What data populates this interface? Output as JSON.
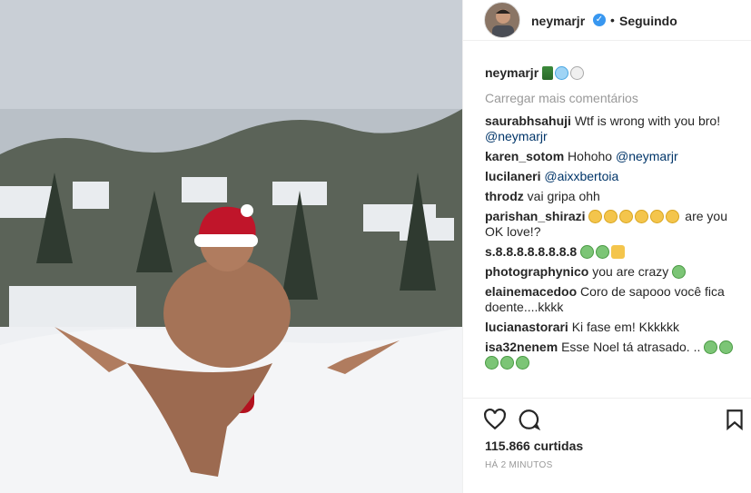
{
  "header": {
    "username": "neymarjr",
    "separator": "•",
    "follow_label": "Seguindo"
  },
  "caption": {
    "username": "neymarjr"
  },
  "load_more": "Carregar mais comentários",
  "comments": [
    {
      "user": "saurabhsahuji",
      "text": "Wtf is wrong with you bro!",
      "mention": "@neymarjr"
    },
    {
      "user": "karen_sotom",
      "text": "Hohoho",
      "mention": "@neymarjr"
    },
    {
      "user": "lucilaneri",
      "mention": "@aixxbertoia"
    },
    {
      "user": "throdz",
      "text": "vai gripa ohh"
    },
    {
      "user": "parishan_shirazi",
      "text": "are you OK love!?"
    },
    {
      "user": "s.8.8.8.8.8.8.8.8"
    },
    {
      "user": "photographynico",
      "text": "you are crazy"
    },
    {
      "user": "elainemacedoo",
      "text": "Coro de sapooo você fica doente....kkkk"
    },
    {
      "user": "lucianastorari",
      "text": "Ki fase em! Kkkkkk"
    },
    {
      "user": "isa32nenem",
      "text": "Esse Noel tá atrasado. .."
    }
  ],
  "likes": "115.866 curtidas",
  "timestamp": "HÁ 2 MINUTOS",
  "icons": {
    "like": "heart-icon",
    "comment": "comment-icon",
    "save": "bookmark-icon",
    "verified": "verified-badge-icon"
  },
  "colors": {
    "link": "#003569",
    "verified": "#3897f0",
    "muted": "#999999"
  }
}
